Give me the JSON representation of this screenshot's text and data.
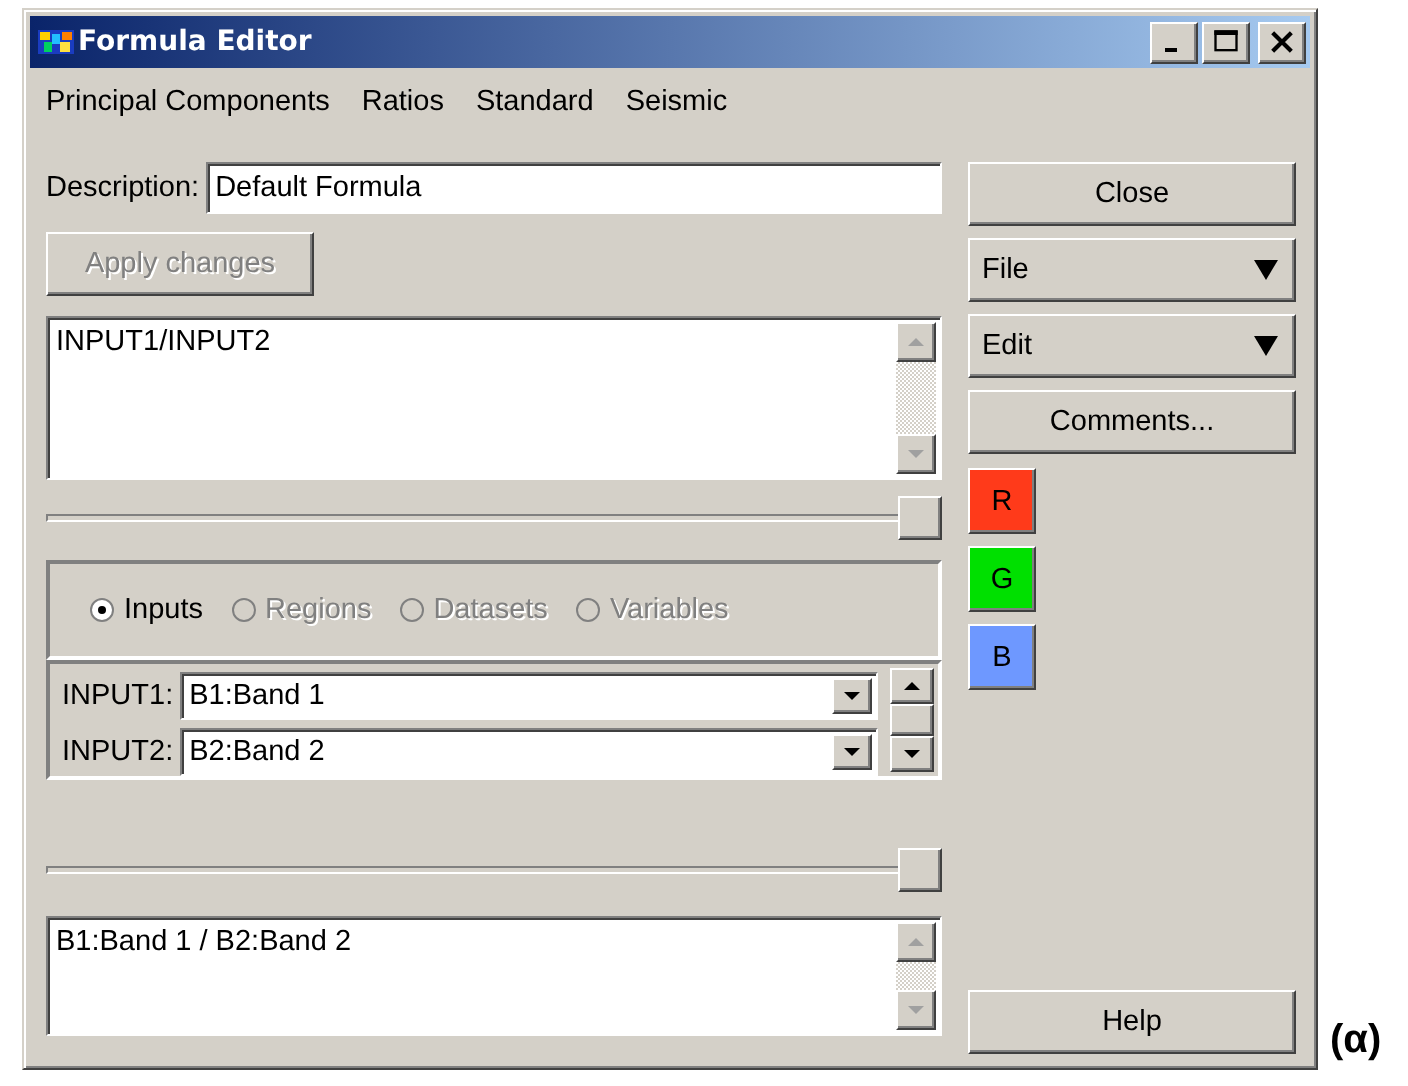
{
  "window": {
    "title": "Formula Editor"
  },
  "menu": [
    {
      "label": "Principal Components"
    },
    {
      "label": "Ratios"
    },
    {
      "label": "Standard"
    },
    {
      "label": "Seismic"
    }
  ],
  "description": {
    "label": "Description:",
    "value": "Default Formula"
  },
  "apply_button": {
    "label": "Apply changes",
    "disabled": true
  },
  "formula": {
    "value": "INPUT1/INPUT2"
  },
  "formula_slider": {
    "level": 1
  },
  "source_options": [
    {
      "label": "Inputs",
      "selected": true,
      "disabled": false
    },
    {
      "label": "Regions",
      "selected": false,
      "disabled": true
    },
    {
      "label": "Datasets",
      "selected": false,
      "disabled": true
    },
    {
      "label": "Variables",
      "selected": false,
      "disabled": true
    }
  ],
  "inputs": [
    {
      "label": "INPUT1:",
      "value": "B1:Band 1"
    },
    {
      "label": "INPUT2:",
      "value": "B2:Band 2"
    }
  ],
  "result_slider": {
    "level": 1
  },
  "result": {
    "value": "B1:Band 1 / B2:Band 2"
  },
  "side_buttons": [
    {
      "label": "Close",
      "kind": "button"
    },
    {
      "label": "File",
      "kind": "menu"
    },
    {
      "label": "Edit",
      "kind": "menu"
    },
    {
      "label": "Comments...",
      "kind": "button"
    }
  ],
  "channels": [
    {
      "label": "R",
      "color": "#ff3a1a"
    },
    {
      "label": "G",
      "color": "#00e000"
    },
    {
      "label": "B",
      "color": "#6e98ff"
    }
  ],
  "help_button": {
    "label": "Help"
  },
  "caption": "(α)"
}
